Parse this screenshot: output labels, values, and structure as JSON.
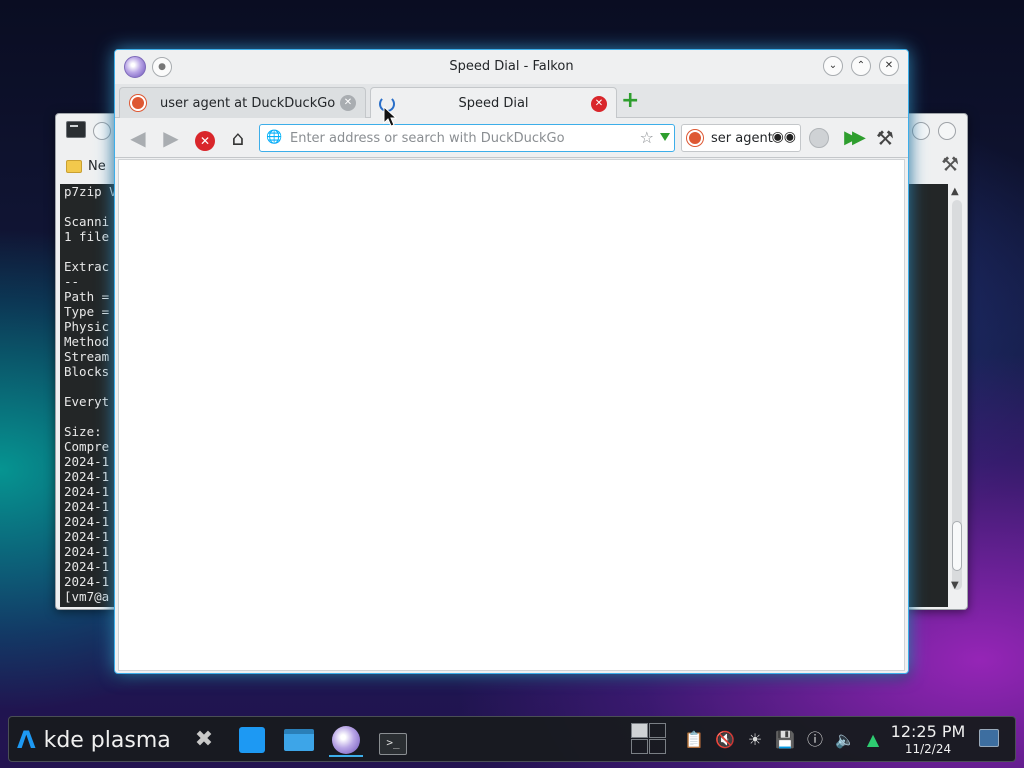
{
  "terminal": {
    "menu_label": "Ne",
    "lines": [
      "p7zip V",
      "",
      "Scanni",
      "1 file",
      "",
      "Extrac",
      "--",
      "Path =",
      "Type =",
      "Physic",
      "Method",
      "Stream",
      "Blocks",
      "",
      "Everyt",
      "",
      "Size:",
      "Compre",
      "2024-1",
      "2024-1",
      "2024-1",
      "2024-1",
      "2024-1",
      "2024-1",
      "2024-1",
      "2024-1",
      "2024-1",
      "[vm7@a"
    ]
  },
  "falkon": {
    "window_title": "Speed Dial - Falkon",
    "tabs": [
      {
        "label": "user agent at DuckDuckGo",
        "icon": "duckduckgo-icon"
      },
      {
        "label": "Speed Dial",
        "icon": "loading-spinner-icon",
        "active": true
      }
    ],
    "url_placeholder": "Enter address or search with DuckDuckGo",
    "url_value": "",
    "search_value": "ser agent",
    "accent": "#3daee9"
  },
  "taskbar": {
    "launcher_label": "kde plasma",
    "clock_time": "12:25 PM",
    "clock_date": "11/2/24"
  }
}
